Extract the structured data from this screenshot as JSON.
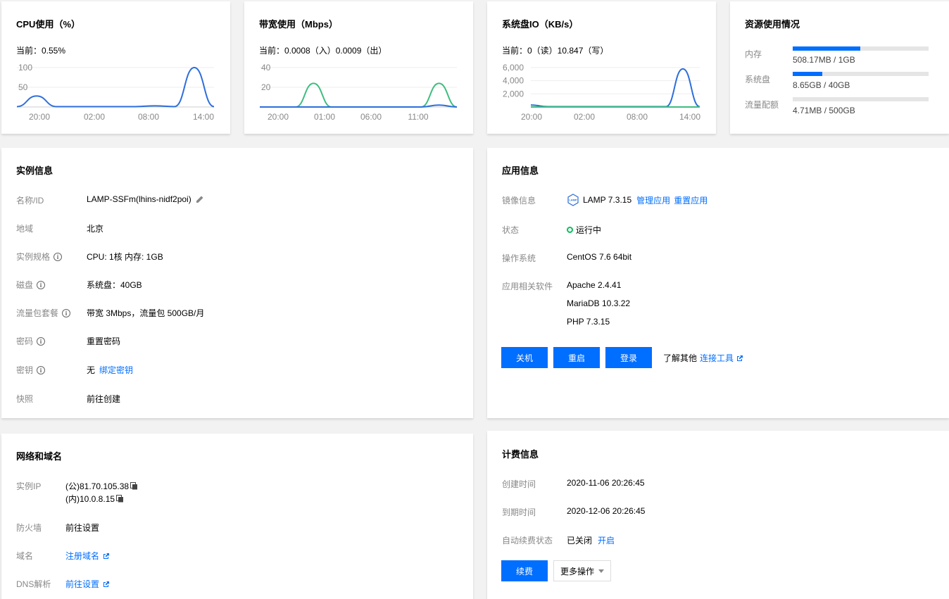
{
  "cpu": {
    "title": "CPU使用（%）",
    "current": "当前：0.55%",
    "y_ticks": [
      "100",
      "50"
    ],
    "x_ticks": [
      "20:00",
      "02:00",
      "08:00",
      "14:00"
    ],
    "chart_data": {
      "type": "line",
      "title": "CPU使用（%）",
      "x": [
        "20:00",
        "02:00",
        "08:00",
        "14:00"
      ],
      "ylim": [
        0,
        100
      ],
      "series": [
        {
          "values": [
            1,
            28,
            1,
            1,
            1,
            1,
            1,
            3,
            1,
            100,
            1
          ]
        }
      ],
      "line_color": "#2d6edc"
    }
  },
  "bandwidth": {
    "title": "带宽使用（Mbps）",
    "current": "当前：0.0008（入）0.0009（出）",
    "y_ticks": [
      "40",
      "20"
    ],
    "x_ticks": [
      "20:00",
      "01:00",
      "06:00",
      "11:00"
    ],
    "chart_data": {
      "type": "line",
      "title": "带宽使用（Mbps）",
      "x": [
        "20:00",
        "01:00",
        "06:00",
        "11:00"
      ],
      "ylim": [
        0,
        40
      ],
      "series": [
        {
          "values": [
            0,
            0,
            0,
            24,
            0,
            0,
            0,
            0,
            0,
            0,
            24,
            0
          ],
          "color": "#3dbd7d"
        },
        {
          "values": [
            0,
            0,
            0,
            0,
            0,
            0,
            0,
            0,
            0,
            0,
            2,
            0
          ],
          "color": "#2d6edc"
        }
      ]
    }
  },
  "disk_io": {
    "title": "系统盘IO（KB/s）",
    "current": "当前：0（读）10.847（写）",
    "y_ticks": [
      "6,000",
      "4,000",
      "2,000"
    ],
    "x_ticks": [
      "20:00",
      "02:00",
      "08:00",
      "14:00"
    ],
    "chart_data": {
      "type": "line",
      "title": "系统盘IO（KB/s）",
      "x": [
        "20:00",
        "02:00",
        "08:00",
        "14:00"
      ],
      "ylim": [
        0,
        6000
      ],
      "series": [
        {
          "values": [
            300,
            50,
            50,
            50,
            50,
            50,
            50,
            50,
            50,
            5800,
            50
          ],
          "color": "#2d6edc"
        },
        {
          "values": [
            0,
            0,
            0,
            0,
            0,
            0,
            0,
            0,
            0,
            0,
            0
          ],
          "color": "#3dbd7d"
        }
      ]
    }
  },
  "resources": {
    "title": "资源使用情况",
    "items": [
      {
        "label": "内存",
        "value": "508.17MB / 1GB",
        "fraction": 0.496
      },
      {
        "label": "系统盘",
        "value": "8.65GB / 40GB",
        "fraction": 0.216
      },
      {
        "label": "流量配额",
        "value": "4.71MB / 500GB",
        "fraction": 0.0
      }
    ]
  },
  "instance": {
    "title": "实例信息",
    "name_label": "名称/ID",
    "name_value": "LAMP-SSFm(lhins-nidf2poi)",
    "region_label": "地域",
    "region_value": "北京",
    "spec_label": "实例规格",
    "spec_value": "CPU: 1核 内存: 1GB",
    "disk_label": "磁盘",
    "disk_value": "系统盘：40GB",
    "traffic_label": "流量包套餐",
    "traffic_value": "带宽 3Mbps，流量包 500GB/月",
    "password_label": "密码",
    "password_link": "重置密码",
    "key_label": "密钥",
    "key_value": "无",
    "key_link": "绑定密钥",
    "snapshot_label": "快照",
    "snapshot_link": "前往创建"
  },
  "app": {
    "title": "应用信息",
    "image_label": "镜像信息",
    "image_icon_text": "LAMP",
    "image_value": "LAMP 7.3.15",
    "manage_link": "管理应用",
    "reset_link": "重置应用",
    "status_label": "状态",
    "status_value": "运行中",
    "os_label": "操作系统",
    "os_value": "CentOS 7.6 64bit",
    "software_label": "应用相关软件",
    "software": [
      "Apache 2.4.41",
      "MariaDB 10.3.22",
      "PHP 7.3.15"
    ],
    "btn_shutdown": "关机",
    "btn_restart": "重启",
    "btn_login": "登录",
    "learn_more": "了解其他",
    "connect_tools": "连接工具"
  },
  "network": {
    "title": "网络和域名",
    "ip_label": "实例IP",
    "public_ip": "(公)81.70.105.38",
    "private_ip": "(内)10.0.8.15",
    "firewall_label": "防火墙",
    "firewall_link": "前往设置",
    "domain_label": "域名",
    "domain_link": "注册域名",
    "dns_label": "DNS解析",
    "dns_link": "前往设置"
  },
  "billing": {
    "title": "计费信息",
    "created_label": "创建时间",
    "created_value": "2020-11-06 20:26:45",
    "expire_label": "到期时间",
    "expire_value": "2020-12-06 20:26:45",
    "autorenew_label": "自动续费状态",
    "autorenew_value": "已关闭",
    "autorenew_link": "开启",
    "btn_renew": "续费",
    "btn_more": "更多操作"
  },
  "colors": {
    "accent": "#006eff",
    "chart_blue": "#2d6edc",
    "chart_green": "#3dbd7d",
    "status_green": "#0abf5b"
  }
}
